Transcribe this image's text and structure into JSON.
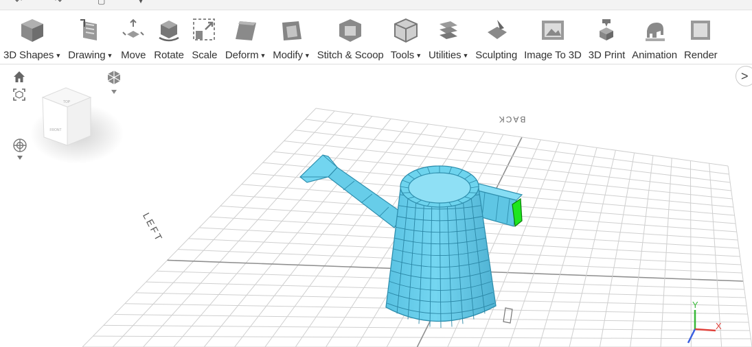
{
  "toolbar": {
    "items": [
      {
        "label": "3D Shapes",
        "dropdown": true,
        "icon": "cube-icon"
      },
      {
        "label": "Drawing",
        "dropdown": true,
        "icon": "drawing-icon"
      },
      {
        "label": "Move",
        "dropdown": false,
        "icon": "move-icon"
      },
      {
        "label": "Rotate",
        "dropdown": false,
        "icon": "rotate-icon"
      },
      {
        "label": "Scale",
        "dropdown": false,
        "icon": "scale-icon"
      },
      {
        "label": "Deform",
        "dropdown": true,
        "icon": "deform-icon"
      },
      {
        "label": "Modify",
        "dropdown": true,
        "icon": "modify-icon"
      },
      {
        "label": "Stitch & Scoop",
        "dropdown": false,
        "icon": "stitch-scoop-icon"
      },
      {
        "label": "Tools",
        "dropdown": true,
        "icon": "tools-icon"
      },
      {
        "label": "Utilities",
        "dropdown": true,
        "icon": "utilities-icon"
      },
      {
        "label": "Sculpting",
        "dropdown": false,
        "icon": "sculpting-icon"
      },
      {
        "label": "Image To 3D",
        "dropdown": false,
        "icon": "image-to-3d-icon"
      },
      {
        "label": "3D Print",
        "dropdown": false,
        "icon": "3d-print-icon"
      },
      {
        "label": "Animation",
        "dropdown": false,
        "icon": "animation-icon"
      },
      {
        "label": "Render",
        "dropdown": false,
        "icon": "render-icon"
      }
    ]
  },
  "viewcube": {
    "top": "TOP",
    "front": "FRONT"
  },
  "viewport": {
    "direction_labels": {
      "back": "BACK",
      "left": "LEFT"
    },
    "axes": {
      "x": "X",
      "y": "Y"
    },
    "model_color": "#6cd0ec",
    "selection_color": "#1ee61e"
  }
}
